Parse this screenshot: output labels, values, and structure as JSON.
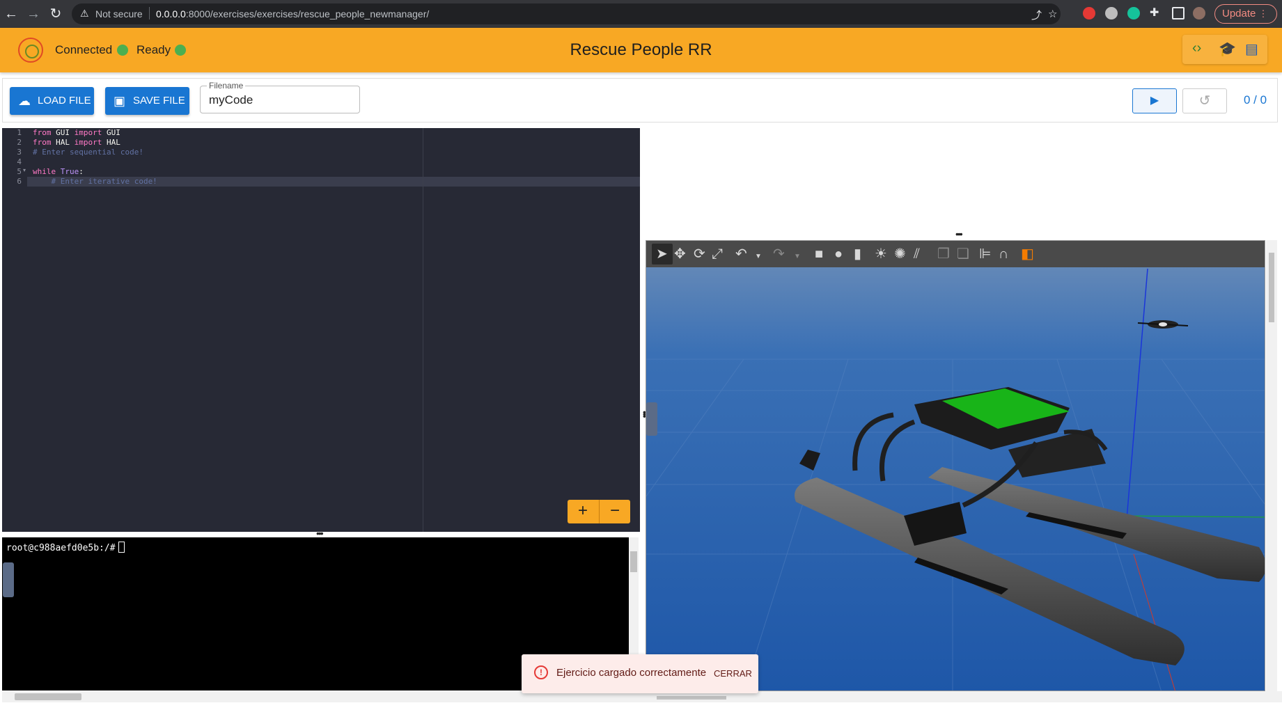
{
  "browser": {
    "security_label": "Not secure",
    "url_host": "0.0.0.0",
    "url_path": ":8000/exercises/exercises/rescue_people_newmanager/",
    "update_label": "Update"
  },
  "appbar": {
    "title": "Rescue People RR",
    "connected_label": "Connected",
    "ready_label": "Ready",
    "status_color": "#4caf50",
    "accent_color": "#f8a824"
  },
  "toolbar": {
    "load_label": "Load file",
    "save_label": "Save file",
    "filename_label": "Filename",
    "filename_value": "myCode",
    "counter": "0 / 0"
  },
  "editor": {
    "line_numbers": [
      "1",
      "2",
      "3",
      "4",
      "5",
      "6"
    ],
    "lines": [
      {
        "kw1": "from",
        "t1": " GUI ",
        "kw2": "import",
        "t2": " GUI"
      },
      {
        "kw1": "from",
        "t1": " HAL ",
        "kw2": "import",
        "t2": " HAL"
      },
      {
        "comment": "# Enter sequential code!"
      },
      {
        "blank": ""
      },
      {
        "kw1": "while",
        "t1": " ",
        "kw2": "True",
        "t2": ":"
      },
      {
        "comment": "    # Enter iterative code!"
      }
    ],
    "zoom_in": "+",
    "zoom_out": "−"
  },
  "terminal": {
    "prompt": "root@c988aefd0e5b:/#"
  },
  "snackbar": {
    "message": "Ejercicio cargado correctamente",
    "close_label": "CERRAR",
    "icon": "!"
  }
}
